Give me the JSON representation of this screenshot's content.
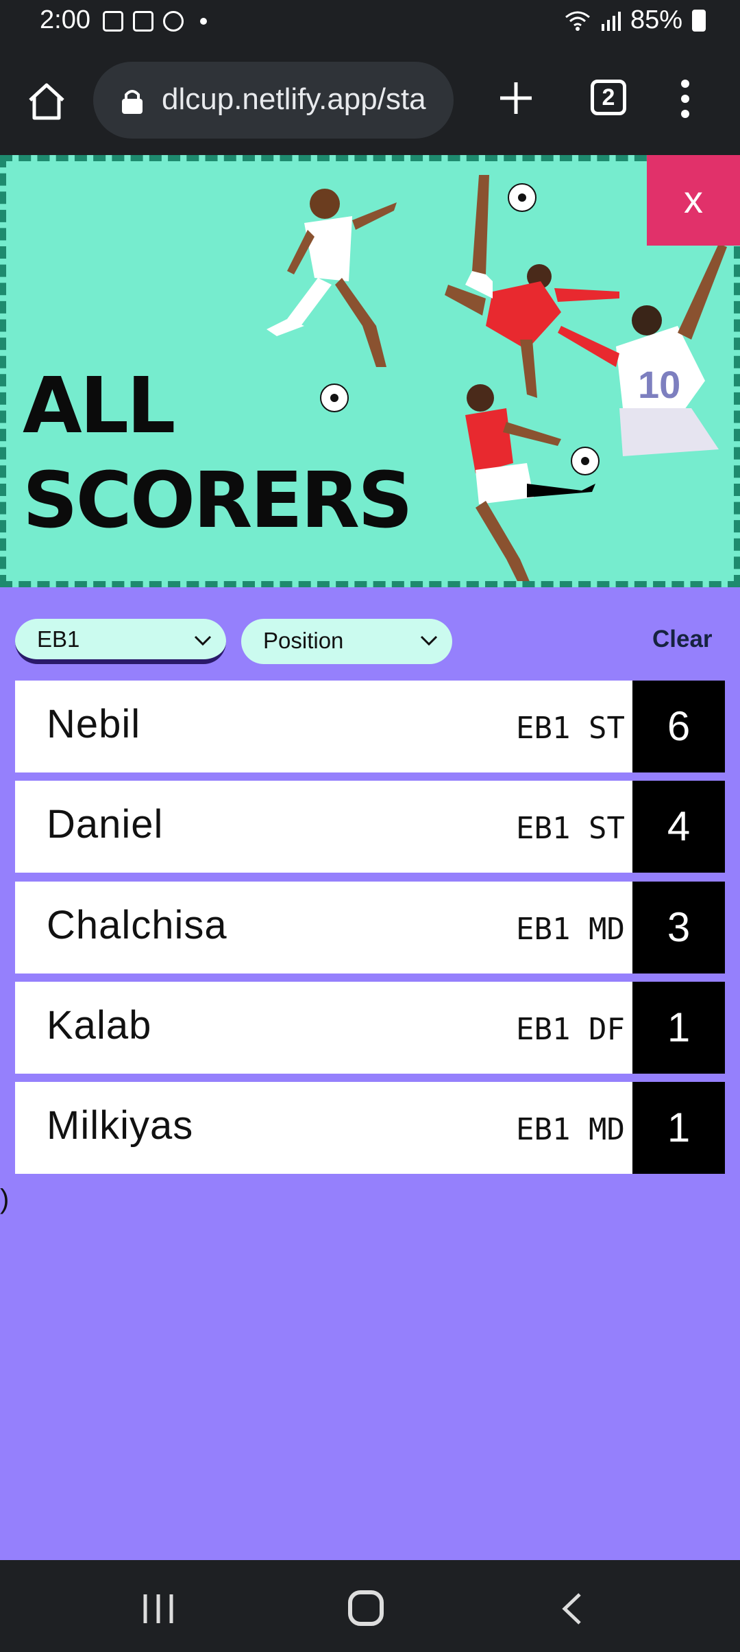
{
  "status_bar": {
    "time": "2:00",
    "battery": "85%"
  },
  "browser": {
    "url": "dlcup.netlify.app/sta",
    "tab_count": "2"
  },
  "hero": {
    "title_line1": "ALL",
    "title_line2": "SCORERS",
    "close_label": "x",
    "jersey_number": "10"
  },
  "filters": {
    "team_value": "EB1",
    "position_value": "Position",
    "clear_label": "Clear"
  },
  "scorers": [
    {
      "name": "Nebil",
      "team": "EB1",
      "position": "ST",
      "goals": "6"
    },
    {
      "name": "Daniel",
      "team": "EB1",
      "position": "ST",
      "goals": "4"
    },
    {
      "name": "Chalchisa",
      "team": "EB1",
      "position": "MD",
      "goals": "3"
    },
    {
      "name": "Kalab",
      "team": "EB1",
      "position": "DF",
      "goals": "1"
    },
    {
      "name": "Milkiyas",
      "team": "EB1",
      "position": "MD",
      "goals": "1"
    }
  ],
  "stray_text": ")"
}
